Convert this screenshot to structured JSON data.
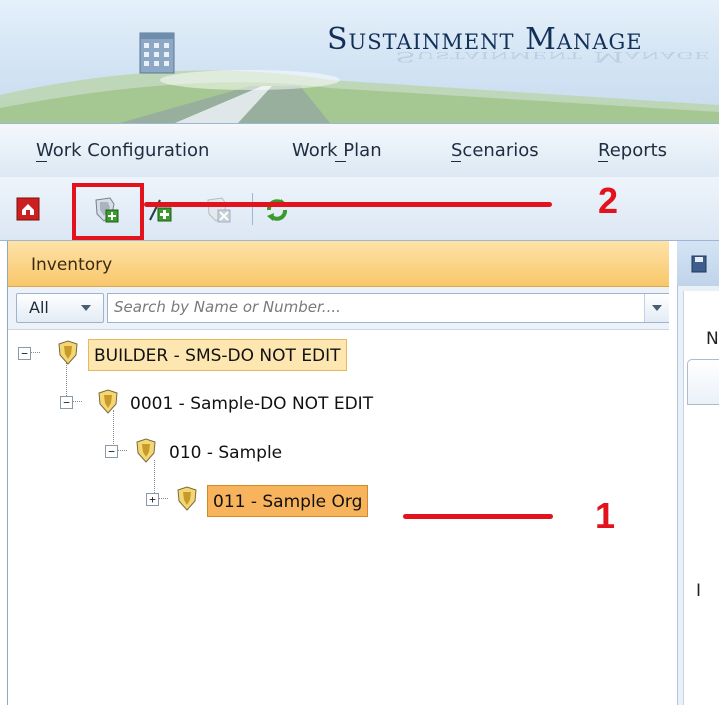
{
  "app": {
    "title": "Sustainment Manage",
    "title_reflection": "Sustainment Manage"
  },
  "menu": {
    "items": [
      {
        "label": "Work Configuration"
      },
      {
        "label": "Work Plan"
      },
      {
        "label": "Scenarios"
      },
      {
        "label": "Reports"
      }
    ]
  },
  "toolbar": {
    "buttons": [
      {
        "icon": "home-icon",
        "color": "#cc1f1f"
      },
      {
        "icon": "add-shield-icon",
        "color": "#3a9a2c"
      },
      {
        "icon": "add-item-icon",
        "color": "#3a9a2c"
      },
      {
        "icon": "delete-shield-icon",
        "color": "#a7b3c0"
      },
      {
        "icon": "refresh-icon",
        "color": "#3a9a2c"
      }
    ]
  },
  "inventory": {
    "header": "Inventory",
    "filter": {
      "selected": "All"
    },
    "search": {
      "placeholder": "Search by Name or Number...."
    },
    "tree": [
      {
        "label": "BUILDER - SMS-DO NOT EDIT",
        "expander": "−",
        "state": "highlighted"
      },
      {
        "label": "0001 - Sample-DO NOT EDIT",
        "expander": "−",
        "state": "normal"
      },
      {
        "label": "010 - Sample",
        "expander": "−",
        "state": "normal"
      },
      {
        "label": "011 - Sample Org",
        "expander": "+",
        "state": "selected"
      }
    ]
  },
  "right_panel": {
    "letter_top": "N",
    "letter_bottom": "I"
  },
  "annotations": {
    "label_1": "1",
    "label_2": "2",
    "color": "#e3131d"
  },
  "colors": {
    "accent": "#f9c76b",
    "selected": "#f7b45c",
    "title": "#12305a"
  }
}
